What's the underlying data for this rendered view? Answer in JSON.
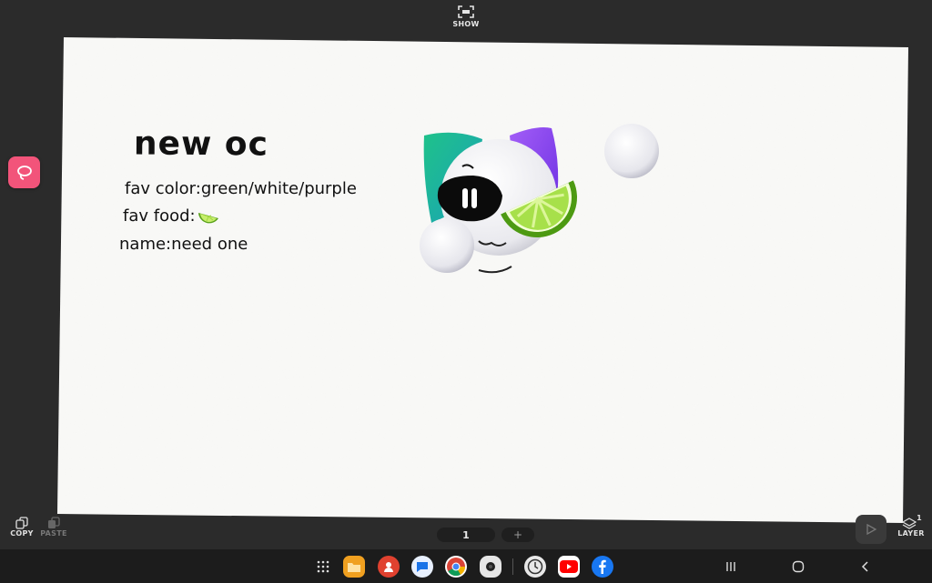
{
  "top_bar": {
    "show_label": "SHOW",
    "show_icon": "fullscreen-icon"
  },
  "canvas_text": {
    "title": "new oc",
    "fav_color": "fav color:green/white/purple",
    "fav_food": "fav food:",
    "name": "name:need one"
  },
  "toolbar": {
    "copy_label": "COPY",
    "paste_label": "PASTE",
    "layer_label": "LAYER",
    "layer_count": "1"
  },
  "pages": {
    "current": "1",
    "add": "+"
  },
  "taskbar": {
    "apps": [
      "app-drawer-icon",
      "my-files-icon",
      "contacts-icon",
      "messages-icon",
      "chrome-icon",
      "camera-icon",
      "clock-icon",
      "youtube-icon",
      "facebook-icon"
    ],
    "nav": [
      "recents-icon",
      "home-icon",
      "back-icon"
    ]
  },
  "colors": {
    "background": "#2b2b2b",
    "paper": "#f9f9f7",
    "accent_pink": "#f2547a",
    "lime_green": "#8ccd2a",
    "teal": "#1fb59a",
    "purple": "#8b3ff0"
  }
}
